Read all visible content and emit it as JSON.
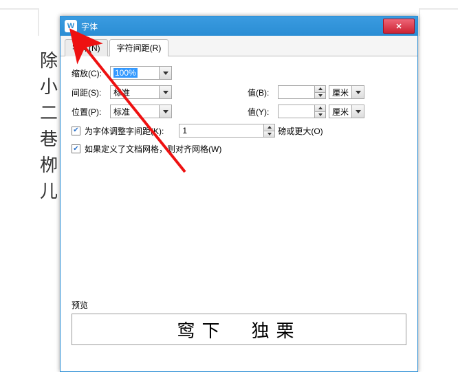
{
  "doc_lines": [
    "除",
    "小",
    "二",
    "巷",
    "栁",
    "儿"
  ],
  "dialog": {
    "title": "字体",
    "app_icon": "W",
    "tabs": {
      "font": "字体(N)",
      "spacing": "字符间距(R)"
    },
    "scale": {
      "label": "缩放(C):",
      "value": "100%"
    },
    "spacing": {
      "label": "间距(S):",
      "value": "标准",
      "value_b_label": "值(B):",
      "value_b": "",
      "unit_b": "厘米"
    },
    "position": {
      "label": "位置(P):",
      "value": "标准",
      "value_y_label": "值(Y):",
      "value_y": "",
      "unit_y": "厘米"
    },
    "kerning": {
      "label": "为字体调整字间距(K):",
      "value": "1",
      "suffix": "磅或更大(O)"
    },
    "snap": {
      "label": "如果定义了文档网格，则对齐网格(W)"
    },
    "preview": {
      "label": "预览",
      "text": "窎下　独栗"
    }
  }
}
